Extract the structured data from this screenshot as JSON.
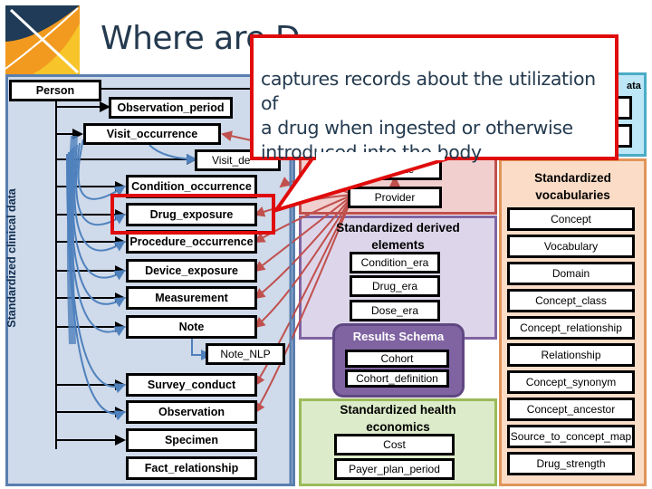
{
  "title": "Where are Drug Exposures in the CDM?",
  "title_visible": "Where are D",
  "callout": {
    "text_lines": [
      "captures records about the utilization of",
      "a drug when ingested or otherwise",
      "introduced into the body"
    ],
    "border_color": "#e00b0b"
  },
  "logo": {
    "icon": "ohdsi-logo-icon",
    "colors": [
      "#1f3b57",
      "#f29a1f",
      "#f7c42a"
    ]
  },
  "clinical": {
    "section_label": "Standardized clinical data",
    "person": "Person",
    "tables": [
      "Observation_period",
      "Visit_occurrence",
      "Visit_detail",
      "Condition_occurrence",
      "Drug_exposure",
      "Procedure_occurrence",
      "Device_exposure",
      "Measurement",
      "Note",
      "Note_NLP",
      "Survey_conduct",
      "Observation",
      "Specimen",
      "Fact_relationship"
    ],
    "visible_partial": {
      "visit_detail": "Visit_de"
    },
    "highlighted": "Drug_exposure",
    "color": "#5a7fb0"
  },
  "health_system": {
    "tables_visible": [
      "Care_site",
      "Provider"
    ],
    "care_site_partial": "are_site",
    "color": "#c0504d"
  },
  "derived": {
    "label": "Standardized derived elements",
    "label_lines": [
      "Standardized derived",
      "elements"
    ],
    "tables": [
      "Condition_era",
      "Drug_era",
      "Dose_era"
    ],
    "color": "#8064a2"
  },
  "results": {
    "label": "Results Schema",
    "tables": [
      "Cohort",
      "Cohort_definition"
    ]
  },
  "health_economics": {
    "label_lines": [
      "Standardized health",
      "economics"
    ],
    "tables": [
      "Cost",
      "Payer_plan_period"
    ],
    "color": "#9bbb59"
  },
  "metadata": {
    "label_partial": "ata",
    "color": "#4bacc6"
  },
  "vocabularies": {
    "label_lines": [
      "Standardized",
      "vocabularies"
    ],
    "tables": [
      "Concept",
      "Vocabulary",
      "Domain",
      "Concept_class",
      "Concept_relationship",
      "Relationship",
      "Concept_synonym",
      "Concept_ancestor",
      "Source_to_concept_map",
      "Drug_strength"
    ],
    "color": "#e0955a"
  }
}
